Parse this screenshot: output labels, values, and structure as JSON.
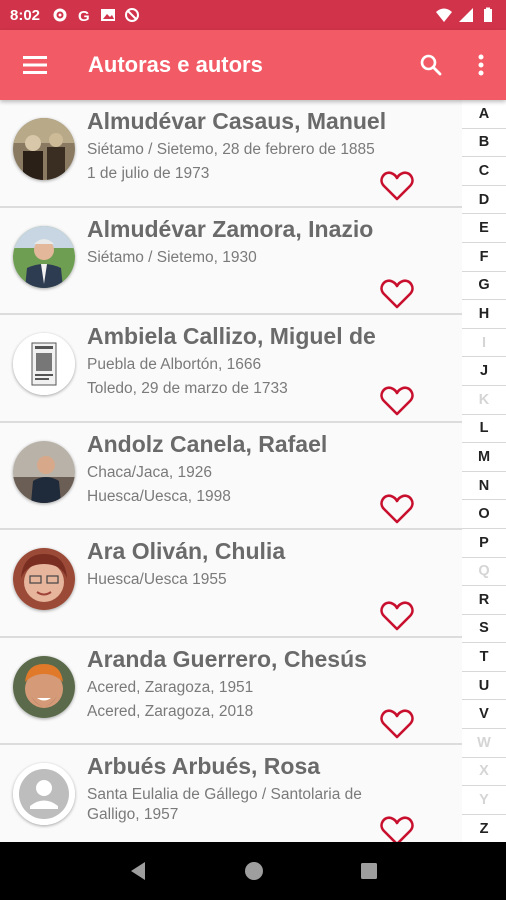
{
  "status_bar": {
    "time": "8:02"
  },
  "app_bar": {
    "title": "Autoras e autors"
  },
  "authors": [
    {
      "name": "Almudévar Casaus, Manuel",
      "line1": "Siétamo / Sietemo, 28 de febrero de 1885",
      "line2": "1 de julio de 1973"
    },
    {
      "name": "Almudévar Zamora, Inazio",
      "line1": "Siétamo / Sietemo, 1930",
      "line2": ""
    },
    {
      "name": "Ambiela Callizo, Miguel de",
      "line1": "Puebla de Albortón, 1666",
      "line2": "Toledo, 29 de marzo de 1733"
    },
    {
      "name": "Andolz Canela, Rafael",
      "line1": "Chaca/Jaca, 1926",
      "line2": "Huesca/Uesca, 1998"
    },
    {
      "name": "Ara Oliván, Chulia",
      "line1": "Huesca/Uesca 1955",
      "line2": ""
    },
    {
      "name": "Aranda Guerrero, Chesús",
      "line1": "Acered, Zaragoza, 1951",
      "line2": "Acered, Zaragoza, 2018"
    },
    {
      "name": "Arbués Arbués, Rosa",
      "line1": "Santa Eulalia de Gállego / Santolaria de Galligo, 1957",
      "line2": ""
    }
  ],
  "alphabet": {
    "A": "A",
    "B": "B",
    "C": "C",
    "D": "D",
    "E": "E",
    "F": "F",
    "G": "G",
    "H": "H",
    "I": "I",
    "J": "J",
    "K": "K",
    "L": "L",
    "M": "M",
    "N": "N",
    "O": "O",
    "P": "P",
    "Q": "Q",
    "R": "R",
    "S": "S",
    "T": "T",
    "U": "U",
    "V": "V",
    "W": "W",
    "X": "X",
    "Y": "Y",
    "Z": "Z"
  },
  "colors": {
    "status_bar": "#d0334a",
    "app_bar": "#f25b66",
    "heart": "#c8102e"
  }
}
